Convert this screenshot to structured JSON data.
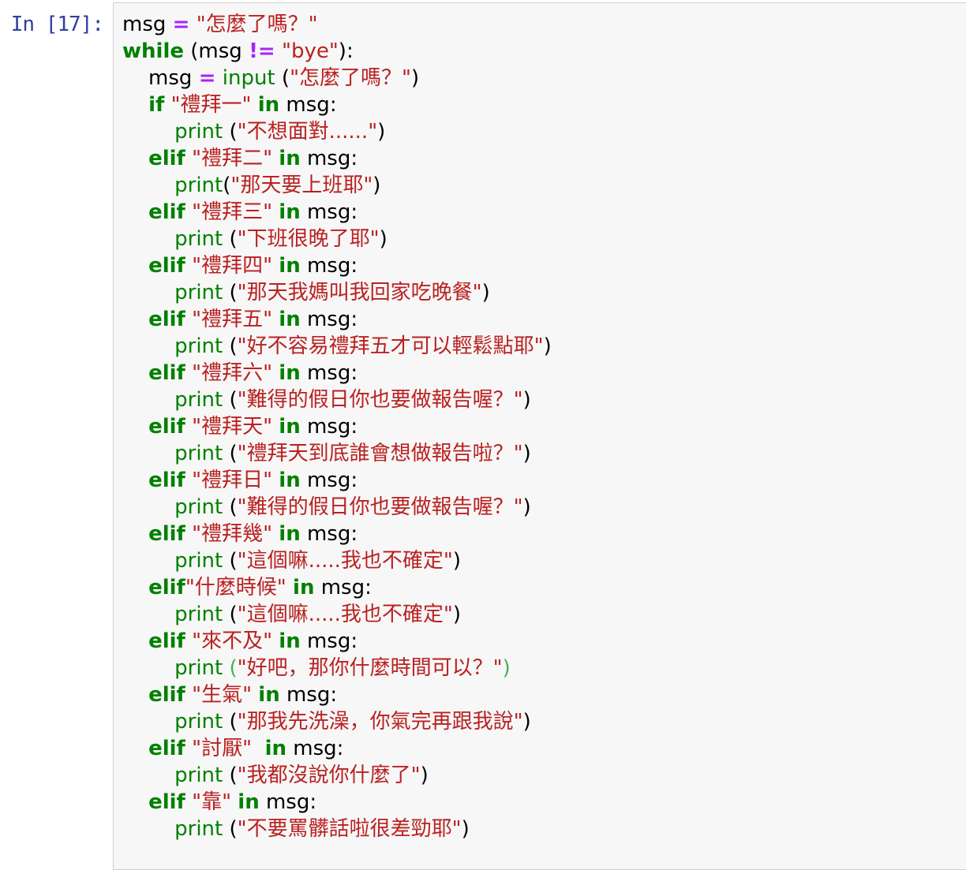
{
  "cell": {
    "prompt": "In [17]:",
    "lines": [
      [
        [
          "",
          "msg "
        ],
        [
          "op",
          "="
        ],
        [
          "",
          " "
        ],
        [
          "str",
          "\"怎麼了嗎？\""
        ]
      ],
      [
        [
          "kw",
          "while"
        ],
        [
          "",
          " (msg "
        ],
        [
          "op",
          "!="
        ],
        [
          "",
          " "
        ],
        [
          "str",
          "\"bye\""
        ],
        [
          "",
          "):"
        ]
      ],
      [
        [
          "",
          "    msg "
        ],
        [
          "op",
          "="
        ],
        [
          "",
          " "
        ],
        [
          "bi",
          "input"
        ],
        [
          "",
          " ("
        ],
        [
          "str",
          "\"怎麼了嗎？\""
        ],
        [
          "",
          ")"
        ]
      ],
      [
        [
          "",
          "    "
        ],
        [
          "kw",
          "if"
        ],
        [
          "",
          " "
        ],
        [
          "str",
          "\"禮拜一\""
        ],
        [
          "",
          " "
        ],
        [
          "kw",
          "in"
        ],
        [
          "",
          " msg:"
        ]
      ],
      [
        [
          "",
          "        "
        ],
        [
          "bi",
          "print"
        ],
        [
          "",
          " ("
        ],
        [
          "str",
          "\"不想面對......\""
        ],
        [
          "",
          ")"
        ]
      ],
      [
        [
          "",
          "    "
        ],
        [
          "kw",
          "elif"
        ],
        [
          "",
          " "
        ],
        [
          "str",
          "\"禮拜二\""
        ],
        [
          "",
          " "
        ],
        [
          "kw",
          "in"
        ],
        [
          "",
          " msg:"
        ]
      ],
      [
        [
          "",
          "        "
        ],
        [
          "bi",
          "print"
        ],
        [
          "",
          "("
        ],
        [
          "str",
          "\"那天要上班耶\""
        ],
        [
          "",
          ")"
        ]
      ],
      [
        [
          "",
          "    "
        ],
        [
          "kw",
          "elif"
        ],
        [
          "",
          " "
        ],
        [
          "str",
          "\"禮拜三\""
        ],
        [
          "",
          " "
        ],
        [
          "kw",
          "in"
        ],
        [
          "",
          " msg:"
        ]
      ],
      [
        [
          "",
          "        "
        ],
        [
          "bi",
          "print"
        ],
        [
          "",
          " ("
        ],
        [
          "str",
          "\"下班很晚了耶\""
        ],
        [
          "",
          ")"
        ]
      ],
      [
        [
          "",
          "    "
        ],
        [
          "kw",
          "elif"
        ],
        [
          "",
          " "
        ],
        [
          "str",
          "\"禮拜四\""
        ],
        [
          "",
          " "
        ],
        [
          "kw",
          "in"
        ],
        [
          "",
          " msg:"
        ]
      ],
      [
        [
          "",
          "        "
        ],
        [
          "bi",
          "print"
        ],
        [
          "",
          " ("
        ],
        [
          "str",
          "\"那天我媽叫我回家吃晚餐\""
        ],
        [
          "",
          ")"
        ]
      ],
      [
        [
          "",
          "    "
        ],
        [
          "kw",
          "elif"
        ],
        [
          "",
          " "
        ],
        [
          "str",
          "\"禮拜五\""
        ],
        [
          "",
          " "
        ],
        [
          "kw",
          "in"
        ],
        [
          "",
          " msg:"
        ]
      ],
      [
        [
          "",
          "        "
        ],
        [
          "bi",
          "print"
        ],
        [
          "",
          " ("
        ],
        [
          "str",
          "\"好不容易禮拜五才可以輕鬆點耶\""
        ],
        [
          "",
          ")"
        ]
      ],
      [
        [
          "",
          "    "
        ],
        [
          "kw",
          "elif"
        ],
        [
          "",
          " "
        ],
        [
          "str",
          "\"禮拜六\""
        ],
        [
          "",
          " "
        ],
        [
          "kw",
          "in"
        ],
        [
          "",
          " msg:"
        ]
      ],
      [
        [
          "",
          "        "
        ],
        [
          "bi",
          "print"
        ],
        [
          "",
          " ("
        ],
        [
          "str",
          "\"難得的假日你也要做報告喔？\""
        ],
        [
          "",
          ")"
        ]
      ],
      [
        [
          "",
          "    "
        ],
        [
          "kw",
          "elif"
        ],
        [
          "",
          " "
        ],
        [
          "str",
          "\"禮拜天\""
        ],
        [
          "",
          " "
        ],
        [
          "kw",
          "in"
        ],
        [
          "",
          " msg:"
        ]
      ],
      [
        [
          "",
          "        "
        ],
        [
          "bi",
          "print"
        ],
        [
          "",
          " ("
        ],
        [
          "str",
          "\"禮拜天到底誰會想做報告啦？\""
        ],
        [
          "",
          ")"
        ]
      ],
      [
        [
          "",
          "    "
        ],
        [
          "kw",
          "elif"
        ],
        [
          "",
          " "
        ],
        [
          "str",
          "\"禮拜日\""
        ],
        [
          "",
          " "
        ],
        [
          "kw",
          "in"
        ],
        [
          "",
          " msg:"
        ]
      ],
      [
        [
          "",
          "        "
        ],
        [
          "bi",
          "print"
        ],
        [
          "",
          " ("
        ],
        [
          "str",
          "\"難得的假日你也要做報告喔？\""
        ],
        [
          "",
          ")"
        ]
      ],
      [
        [
          "",
          "    "
        ],
        [
          "kw",
          "elif"
        ],
        [
          "",
          " "
        ],
        [
          "str",
          "\"禮拜幾\""
        ],
        [
          "",
          " "
        ],
        [
          "kw",
          "in"
        ],
        [
          "",
          " msg:"
        ]
      ],
      [
        [
          "",
          "        "
        ],
        [
          "bi",
          "print"
        ],
        [
          "",
          " ("
        ],
        [
          "str",
          "\"這個嘛.....我也不確定\""
        ],
        [
          "",
          ")"
        ]
      ],
      [
        [
          "",
          "    "
        ],
        [
          "kw",
          "elif"
        ],
        [
          "str",
          "\"什麼時候\""
        ],
        [
          "",
          " "
        ],
        [
          "kw",
          "in"
        ],
        [
          "",
          " msg:"
        ]
      ],
      [
        [
          "",
          "        "
        ],
        [
          "bi",
          "print"
        ],
        [
          "",
          " ("
        ],
        [
          "str",
          "\"這個嘛.....我也不確定\""
        ],
        [
          "",
          ")"
        ]
      ],
      [
        [
          "",
          "    "
        ],
        [
          "kw",
          "elif"
        ],
        [
          "",
          " "
        ],
        [
          "str",
          "\"來不及\""
        ],
        [
          "",
          " "
        ],
        [
          "kw",
          "in"
        ],
        [
          "",
          " msg:"
        ]
      ],
      [
        [
          "",
          "        "
        ],
        [
          "bi",
          "print"
        ],
        [
          "",
          " "
        ],
        [
          "bgr",
          "("
        ],
        [
          "str",
          "\"好吧，那你什麼時間可以？\""
        ],
        [
          "bgr",
          ")"
        ]
      ],
      [
        [
          "",
          "    "
        ],
        [
          "kw",
          "elif"
        ],
        [
          "",
          " "
        ],
        [
          "str",
          "\"生氣\""
        ],
        [
          "",
          " "
        ],
        [
          "kw",
          "in"
        ],
        [
          "",
          " msg:"
        ]
      ],
      [
        [
          "",
          "        "
        ],
        [
          "bi",
          "print"
        ],
        [
          "",
          " ("
        ],
        [
          "str",
          "\"那我先洗澡，你氣完再跟我說\""
        ],
        [
          "",
          ")"
        ]
      ],
      [
        [
          "",
          "    "
        ],
        [
          "kw",
          "elif"
        ],
        [
          "",
          " "
        ],
        [
          "str",
          "\"討厭\""
        ],
        [
          "",
          "  "
        ],
        [
          "kw",
          "in"
        ],
        [
          "",
          " msg:"
        ]
      ],
      [
        [
          "",
          "        "
        ],
        [
          "bi",
          "print"
        ],
        [
          "",
          " ("
        ],
        [
          "str",
          "\"我都沒說你什麼了\""
        ],
        [
          "",
          ")"
        ]
      ],
      [
        [
          "",
          "    "
        ],
        [
          "kw",
          "elif"
        ],
        [
          "",
          " "
        ],
        [
          "str",
          "\"靠\""
        ],
        [
          "",
          " "
        ],
        [
          "kw",
          "in"
        ],
        [
          "",
          " msg:"
        ]
      ],
      [
        [
          "",
          "        "
        ],
        [
          "bi",
          "print"
        ],
        [
          "",
          " ("
        ],
        [
          "str",
          "\"不要罵髒話啦很差勁耶\""
        ],
        [
          "",
          ")"
        ]
      ]
    ]
  }
}
